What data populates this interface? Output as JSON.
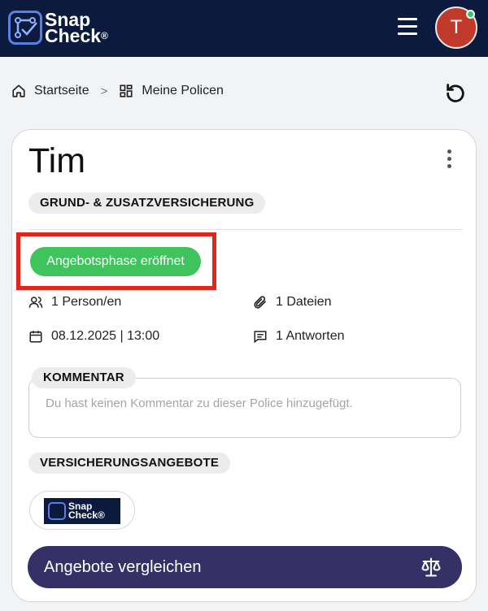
{
  "header": {
    "logo_line1": "Snap",
    "logo_line2": "Check",
    "logo_reg": "®",
    "avatar_initial": "T"
  },
  "breadcrumb": {
    "home": "Startseite",
    "separator": ">",
    "current": "Meine Policen"
  },
  "policy": {
    "holder_name": "Tim",
    "category": "GRUND- & ZUSATZVERSICHERUNG",
    "status": "Angebotsphase eröffnet",
    "persons": "1 Person/en",
    "files": "1 Dateien",
    "date": "08.12.2025 | 13:00",
    "answers": "1 Antworten",
    "comment_label": "KOMMENTAR",
    "comment_placeholder": "Du hast keinen Kommentar zu dieser Police hinzugefügt.",
    "offers_label": "VERSICHERUNGSANGEBOTE",
    "offer_logo_line1": "Snap",
    "offer_logo_line2": "Check®",
    "compare_button": "Angebote vergleichen"
  },
  "icons": {
    "home": "home-icon",
    "dashboard": "grid-icon",
    "refresh": "refresh-icon",
    "menu": "hamburger-icon",
    "kebab": "more-vertical-icon",
    "persons": "users-icon",
    "files": "paperclip-icon",
    "date": "calendar-icon",
    "answers": "chat-icon",
    "compare": "scales-icon"
  },
  "colors": {
    "header_bg": "#0b1a3d",
    "status_green": "#3fc35c",
    "highlight_red": "#e3241b",
    "button_purple": "#353167",
    "avatar_red": "#c0392b"
  }
}
